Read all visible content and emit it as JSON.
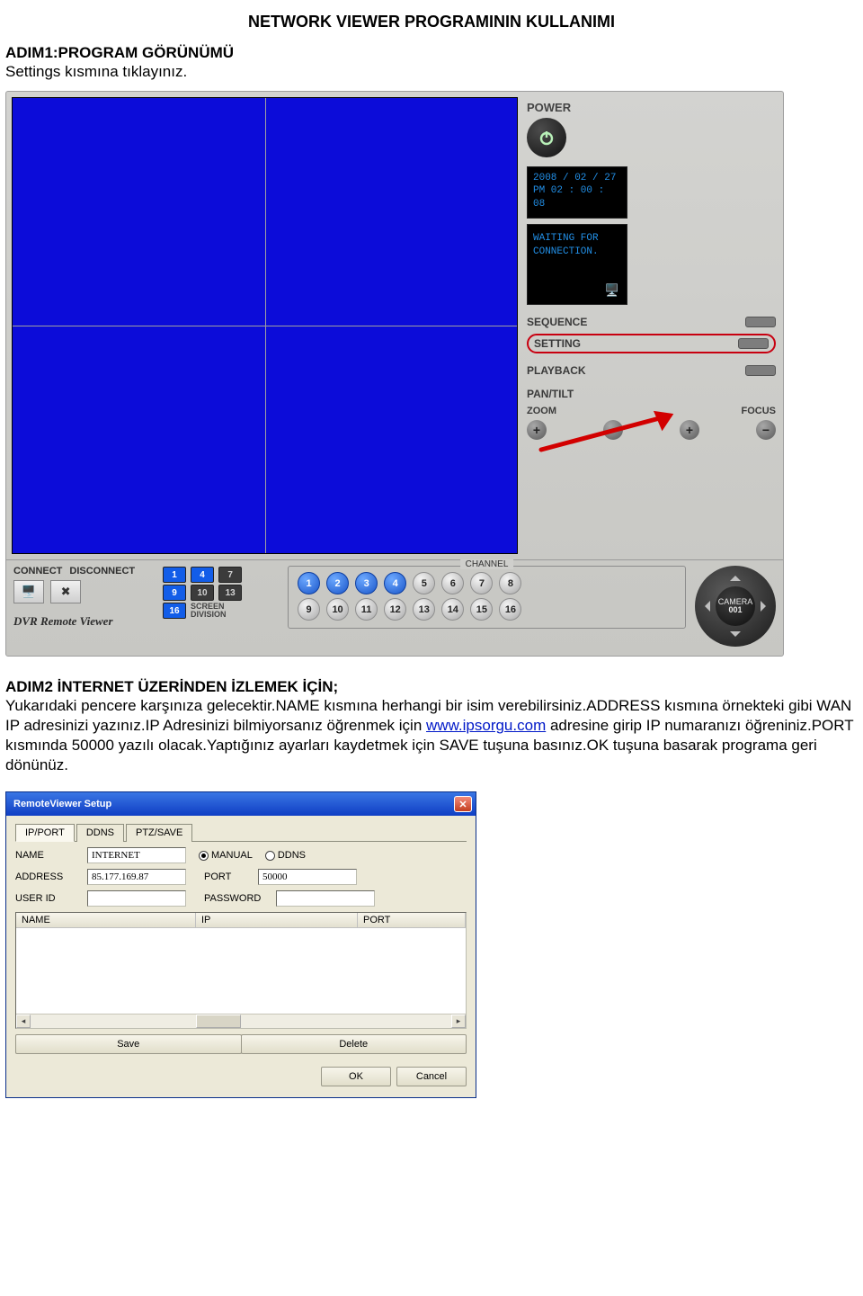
{
  "doc": {
    "title": "NETWORK VIEWER PROGRAMININ KULLANIMI",
    "step1_head": "ADIM1:PROGRAM GÖRÜNÜMÜ",
    "step1_body": "Settings kısmına tıklayınız.",
    "step2_head": "ADIM2 İNTERNET ÜZERİNDEN İZLEMEK İÇİN;",
    "step2_body_a": "Yukarıdaki pencere karşınıza gelecektir.NAME kısmına herhangi bir isim verebilirsiniz.ADDRESS kısmına örnekteki gibi WAN IP adresinizi yazınız.IP Adresinizi bilmiyorsanız öğrenmek için ",
    "step2_link": "www.ipsorgu.com",
    "step2_body_b": " adresine girip IP numaranızı öğreniniz.PORT kısmında 50000 yazılı olacak.Yaptığınız ayarları kaydetmek için SAVE tuşuna basınız.OK tuşuna basarak programa geri dönünüz."
  },
  "viewer": {
    "power": "POWER",
    "date": "2008 / 02 / 27",
    "time": "PM 02 : 00 : 08",
    "wait": "WAITING FOR CONNECTION.",
    "seq": "SEQUENCE",
    "setting": "SETTING",
    "playback": "PLAYBACK",
    "pantilt": "PAN/TILT",
    "zoom": "ZOOM",
    "focus": "FOCUS",
    "connect": "CONNECT",
    "disconnect": "DISCONNECT",
    "brand": "DVR Remote Viewer",
    "screen_div": "SCREEN\nDIVISION",
    "channel": "CHANNEL",
    "camera": "CAMERA",
    "cam_no": "001",
    "grid_buttons": [
      "1",
      "4",
      "7",
      "9",
      "10",
      "13",
      "16"
    ],
    "channels": [
      "1",
      "2",
      "3",
      "4",
      "5",
      "6",
      "7",
      "8",
      "9",
      "10",
      "11",
      "12",
      "13",
      "14",
      "15",
      "16"
    ]
  },
  "dlg": {
    "title": "RemoteViewer Setup",
    "tabs": [
      "IP/PORT",
      "DDNS",
      "PTZ/SAVE"
    ],
    "name_lbl": "NAME",
    "addr_lbl": "ADDRESS",
    "user_lbl": "USER ID",
    "port_lbl": "PORT",
    "pass_lbl": "PASSWORD",
    "manual": "MANUAL",
    "ddns": "DDNS",
    "name_val": "INTERNET",
    "addr_val": "85.177.169.87",
    "port_val": "50000",
    "user_val": "",
    "pass_val": "",
    "list_name": "NAME",
    "list_ip": "IP",
    "list_port": "PORT",
    "save": "Save",
    "delete": "Delete",
    "ok": "OK",
    "cancel": "Cancel"
  }
}
